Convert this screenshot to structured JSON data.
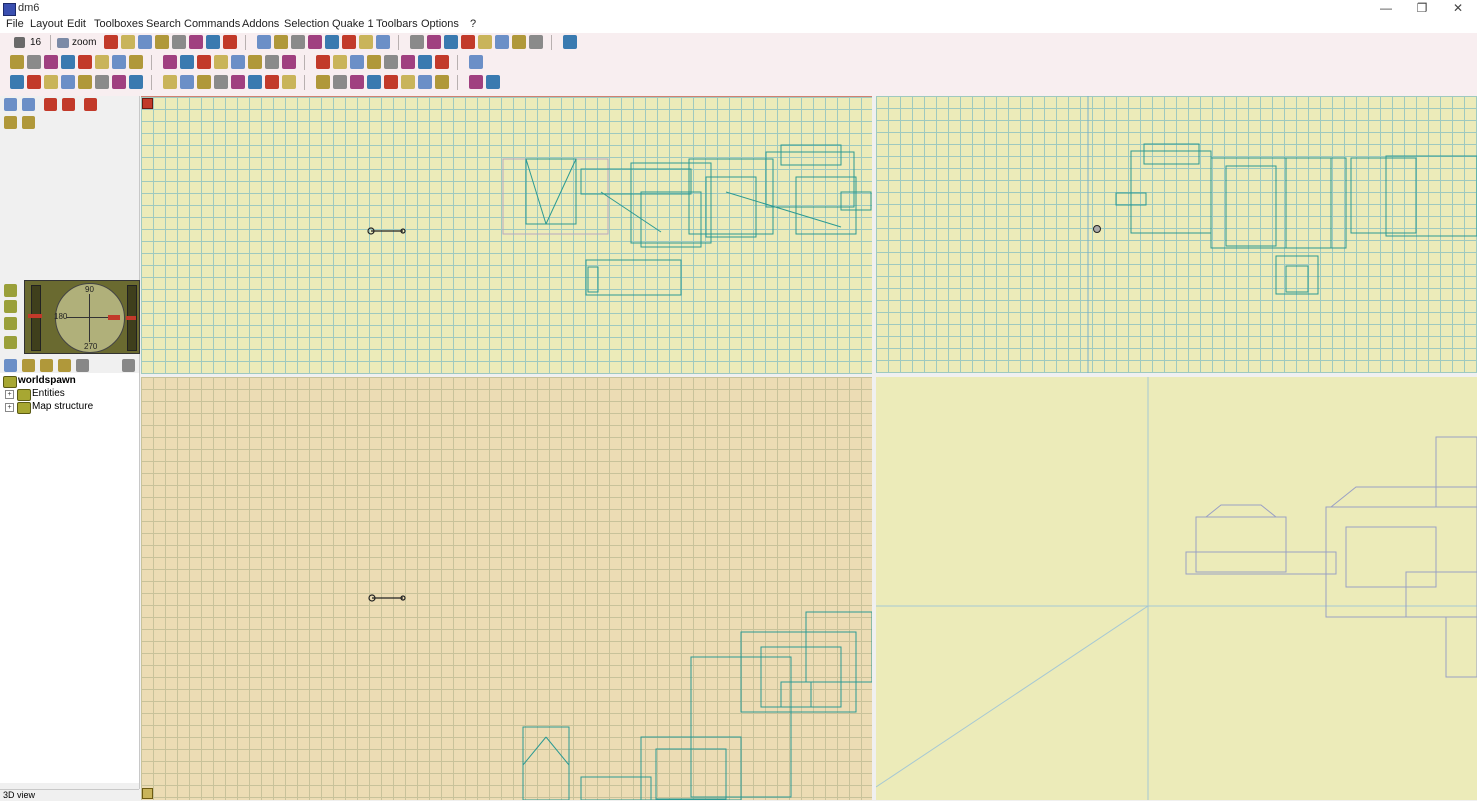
{
  "window": {
    "title": "dm6",
    "minimize_glyph": "—",
    "maximize_glyph": "❐",
    "close_glyph": "✕"
  },
  "menu": [
    "File",
    "Layout",
    "Edit",
    "Toolboxes",
    "Search",
    "Commands",
    "Addons",
    "Selection",
    "Quake 1",
    "Toolbars",
    "Options",
    "?"
  ],
  "toolbar": {
    "grid_value": "16",
    "zoom_label": "zoom"
  },
  "compass": {
    "north": "90",
    "west": "180",
    "south": "270"
  },
  "tree": {
    "root": "worldspawn",
    "children": [
      {
        "label": "Entities",
        "expand": "+"
      },
      {
        "label": "Map structure",
        "expand": "+"
      }
    ]
  },
  "status": {
    "left_text": "3D view"
  },
  "colors": {
    "brush_selected": "#2b9a93",
    "brush_3d": "#9aa0c4",
    "grid_top": "#ecebb9",
    "grid_side": "#ecdcb4",
    "toolbar_icon_red": "#c23a2a",
    "toolbar_icon_yellow": "#c9b45a"
  },
  "icons": [
    "grid-icon",
    "zoom-icon",
    "camera-icon",
    "brush-icon",
    "entity-icon",
    "compass-icon",
    "worldspawn-icon",
    "folder-icon"
  ]
}
